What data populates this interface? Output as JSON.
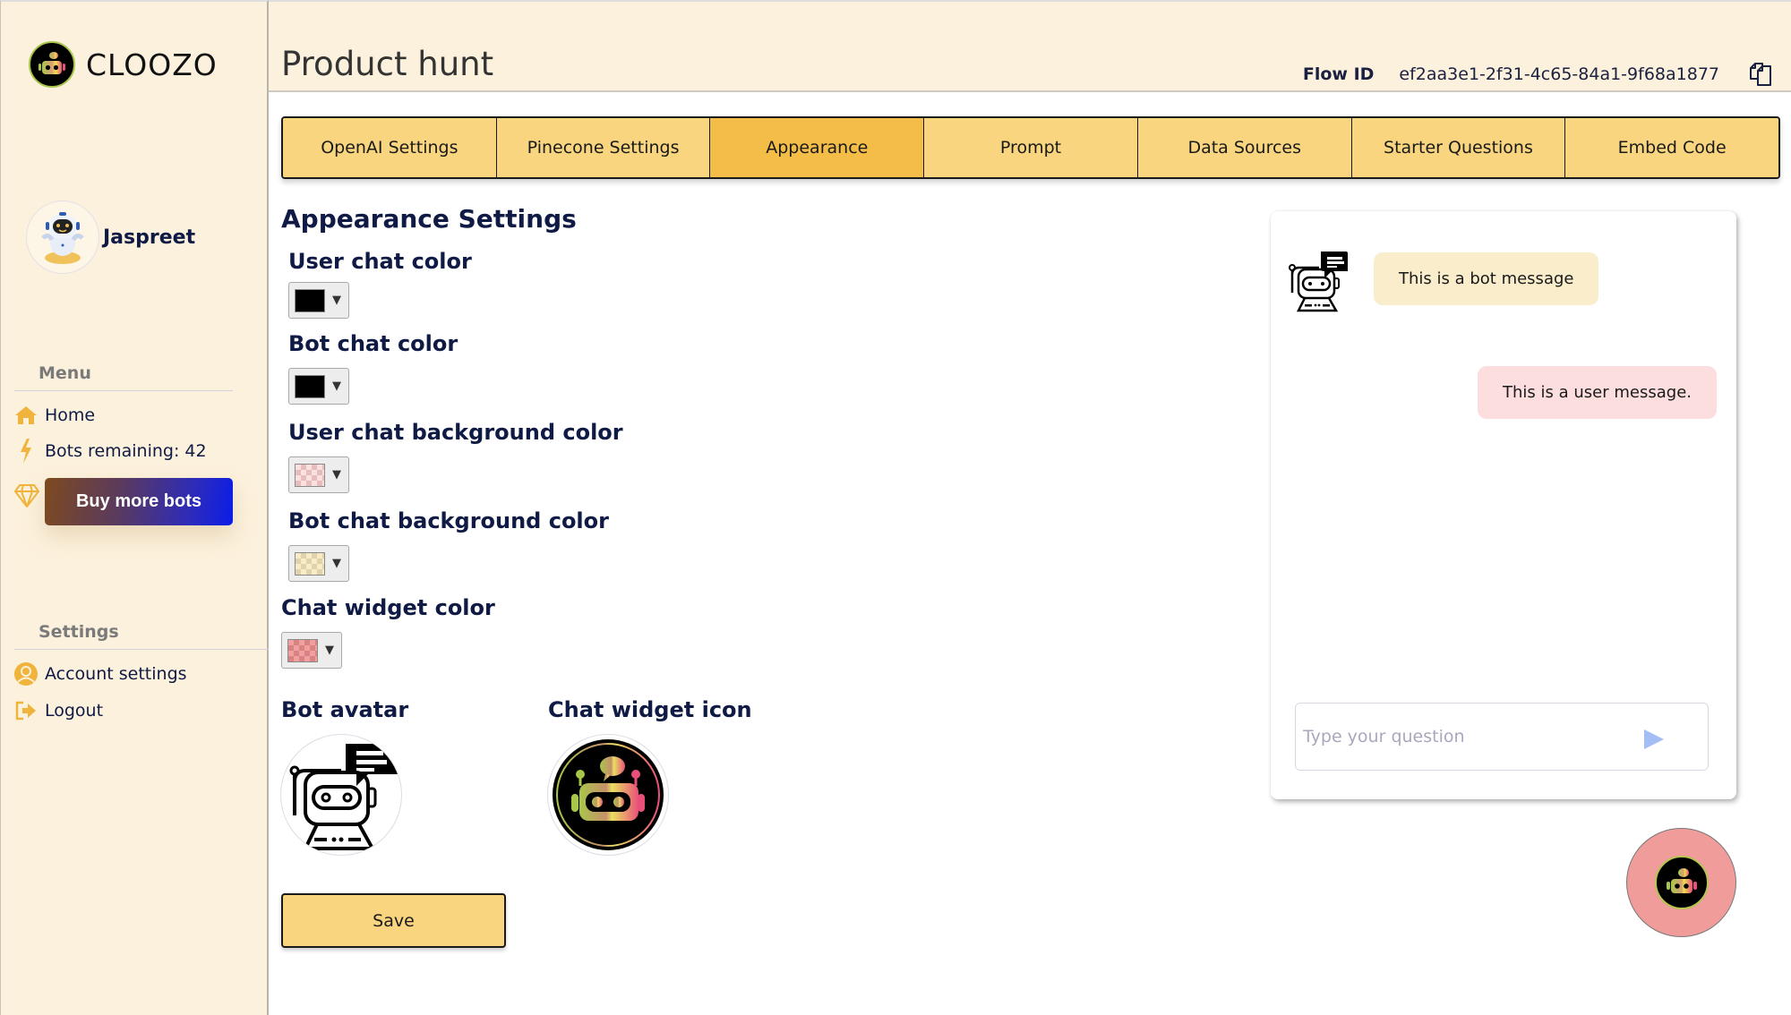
{
  "brand": {
    "name": "CLOOZO",
    "logo_icon": "robot-logo-icon"
  },
  "user": {
    "name": "Jaspreet",
    "avatar_icon": "robot-avatar-icon"
  },
  "sidebar": {
    "menu_title": "Menu",
    "menu_items": [
      {
        "label": "Home",
        "icon": "home-icon"
      },
      {
        "label": "Bots remaining: 42",
        "icon": "lightning-icon"
      }
    ],
    "buy_button": {
      "label": "Buy more bots",
      "icon": "diamond-icon"
    },
    "settings_title": "Settings",
    "settings_items": [
      {
        "label": "Account settings",
        "icon": "user-circle-icon"
      },
      {
        "label": "Logout",
        "icon": "logout-icon"
      }
    ]
  },
  "header": {
    "title": "Product hunt",
    "flow_id_label": "Flow ID",
    "flow_id_value": "ef2aa3e1-2f31-4c65-84a1-9f68a1877",
    "copy_icon": "copy-icon"
  },
  "tabs": [
    {
      "label": "OpenAI Settings",
      "active": false
    },
    {
      "label": "Pinecone Settings",
      "active": false
    },
    {
      "label": "Appearance",
      "active": true
    },
    {
      "label": "Prompt",
      "active": false
    },
    {
      "label": "Data Sources",
      "active": false
    },
    {
      "label": "Starter Questions",
      "active": false
    },
    {
      "label": "Embed Code",
      "active": false
    }
  ],
  "appearance": {
    "heading": "Appearance Settings",
    "fields": [
      {
        "label": "User chat color",
        "color": "#000000"
      },
      {
        "label": "Bot chat color",
        "color": "#000000"
      },
      {
        "label": "User chat background color",
        "color": "#fcdede"
      },
      {
        "label": "Bot chat background color",
        "color": "#f9edcb"
      },
      {
        "label": "Chat widget color",
        "color": "#f09c9a"
      }
    ],
    "bot_avatar_label": "Bot avatar",
    "chat_widget_icon_label": "Chat widget icon",
    "save_label": "Save"
  },
  "preview": {
    "bot_message": "This is a bot message",
    "user_message": "This is a user message.",
    "input_placeholder": "Type your question",
    "send_icon": "send-icon",
    "widget_icon": "chat-widget-icon"
  },
  "colors": {
    "sidebar_bg": "#fcf1dc",
    "tab_bg": "#f8d57e",
    "tab_active_bg": "#f3bd47",
    "accent_icon": "#f0b43c",
    "text_navy": "#0f1a45"
  }
}
